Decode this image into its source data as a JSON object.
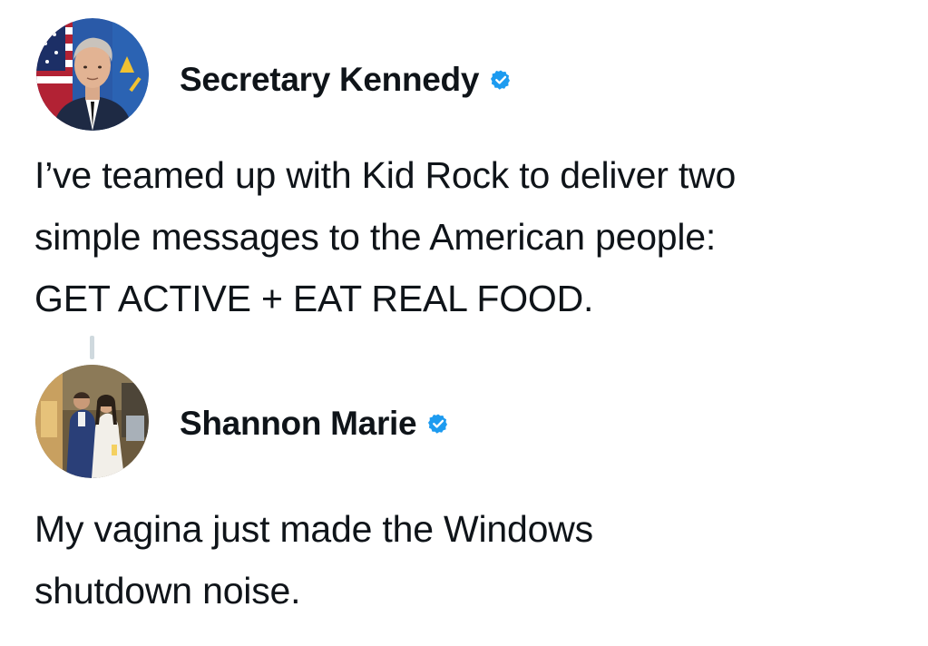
{
  "posts": [
    {
      "author": {
        "display_name": "Secretary Kennedy",
        "verified_icon": "verified-badge-icon",
        "avatar": "avatar-photo"
      },
      "text": "I’ve teamed up with Kid Rock to deliver two\nsimple messages to the American people:\nGET ACTIVE + EAT REAL FOOD."
    },
    {
      "author": {
        "display_name": "Shannon Marie",
        "verified_icon": "verified-badge-icon",
        "avatar": "avatar-photo"
      },
      "text": "My vagina just made the Windows\nshutdown noise."
    }
  ],
  "colors": {
    "verified_blue": "#1d9bf0",
    "text": "#0f1419",
    "thread_line": "#cfd9de",
    "background": "#ffffff"
  }
}
